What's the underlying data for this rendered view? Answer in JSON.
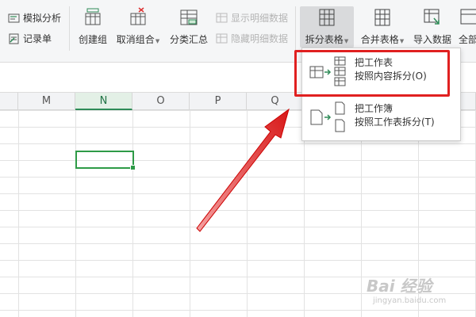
{
  "ribbon": {
    "simulation_analysis": "模拟分析",
    "record_sheet": "记录单",
    "create_group": "创建组",
    "ungroup": "取消组合",
    "subtotal": "分类汇总",
    "show_detail": "显示明细数据",
    "hide_detail": "隐藏明细数据",
    "split_table": "拆分表格",
    "merge_table": "合并表格",
    "import_data": "导入数据",
    "all": "全部"
  },
  "columns": [
    "M",
    "N",
    "O",
    "P",
    "Q"
  ],
  "selected_column": "N",
  "dropdown": {
    "items": [
      {
        "line1": "把工作表",
        "line2": "按照内容拆分(O)"
      },
      {
        "line1": "把工作簿",
        "line2": "按照工作表拆分(T)"
      }
    ]
  },
  "watermark": {
    "brand": "Bai 经验",
    "url": "jingyan.baidu.com"
  },
  "colors": {
    "accent_green": "#2e9b47",
    "highlight_red": "#e02020"
  }
}
